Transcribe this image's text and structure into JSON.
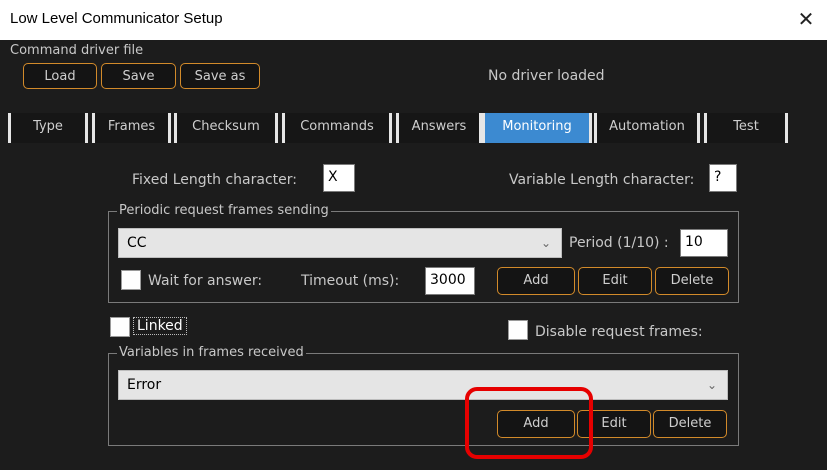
{
  "window": {
    "title": "Low Level Communicator Setup",
    "close_glyph": "✕"
  },
  "driver": {
    "section_label": "Command driver file",
    "buttons": {
      "load": "Load",
      "save": "Save",
      "save_as": "Save as"
    },
    "status": "No driver loaded"
  },
  "tabs": [
    {
      "label": "Type"
    },
    {
      "label": "Frames"
    },
    {
      "label": "Checksum"
    },
    {
      "label": "Commands"
    },
    {
      "label": "Answers"
    },
    {
      "label": "Monitoring",
      "active": true
    },
    {
      "label": "Automation"
    },
    {
      "label": "Test"
    }
  ],
  "monitoring": {
    "fixed_length_label": "Fixed Length character:",
    "fixed_length_value": "X",
    "variable_length_label": "Variable Length character:",
    "variable_length_value": "?",
    "periodic": {
      "legend": "Periodic request frames sending",
      "selected": "CC",
      "period_label": "Period (1/10) :",
      "period_value": "10",
      "wait_label": "Wait for answer:",
      "timeout_label": "Timeout (ms):",
      "timeout_value": "3000",
      "buttons": {
        "add": "Add",
        "edit": "Edit",
        "delete": "Delete"
      }
    },
    "linked_label": "Linked",
    "disable_label": "Disable request frames:",
    "variables": {
      "legend": "Variables in frames received",
      "selected": "Error",
      "buttons": {
        "add": "Add",
        "edit": "Edit",
        "delete": "Delete"
      }
    }
  },
  "icons": {
    "chevron": "chevron-down-icon",
    "close": "close-icon"
  },
  "colors": {
    "accent_border": "#d28a2a",
    "active_tab": "#3c8ad1",
    "highlight": "#e60000"
  }
}
